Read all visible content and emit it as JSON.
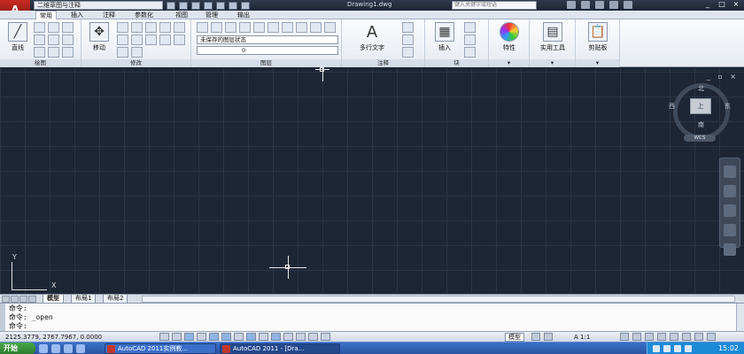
{
  "titlebar": {
    "workspace": "二维草图与注释",
    "document_title": "Drawing1.dwg",
    "search_placeholder": "键入关键字或短语",
    "window_controls": [
      "_",
      "□",
      "×"
    ]
  },
  "ribbon_tabs": [
    "常用",
    "插入",
    "注释",
    "参数化",
    "视图",
    "管理",
    "输出"
  ],
  "ribbon_active_tab": "常用",
  "panels": {
    "draw": {
      "label": "绘图",
      "line_label": "直线"
    },
    "modify": {
      "label": "修改",
      "move_label": "移动"
    },
    "layers": {
      "label": "图层",
      "layer_state": "未保存的图层状态",
      "current_layer": "0"
    },
    "annotation": {
      "label": "注释",
      "mtext_label": "多行文字"
    },
    "block": {
      "label": "块",
      "insert_label": "插入"
    },
    "properties": {
      "label": "特性"
    },
    "utilities": {
      "label": "实用工具"
    },
    "clipboard": {
      "label": "剪贴板"
    }
  },
  "viewcube": {
    "north": "北",
    "south": "南",
    "east": "东",
    "west": "西",
    "face": "上",
    "wcs": "WCS"
  },
  "ucs": {
    "x": "X",
    "y": "Y"
  },
  "layout_tabs": [
    "模型",
    "布局1",
    "布局2"
  ],
  "layout_active": "模型",
  "command_lines": [
    "命令:",
    "命令: _open",
    "命令:"
  ],
  "status": {
    "coordinates": "2125.3779,  2767.7967, 0.0000",
    "model": "模型",
    "scale": "1:1"
  },
  "taskbar": {
    "start": "开始",
    "tasks": [
      "AutoCAD 2011实例教...",
      "AutoCAD 2011 - [Dra..."
    ],
    "clock": "15:02"
  },
  "colors": {
    "canvas": "#1e2636",
    "app_button": "#c92a22",
    "taskbar": "#2a55a4"
  }
}
